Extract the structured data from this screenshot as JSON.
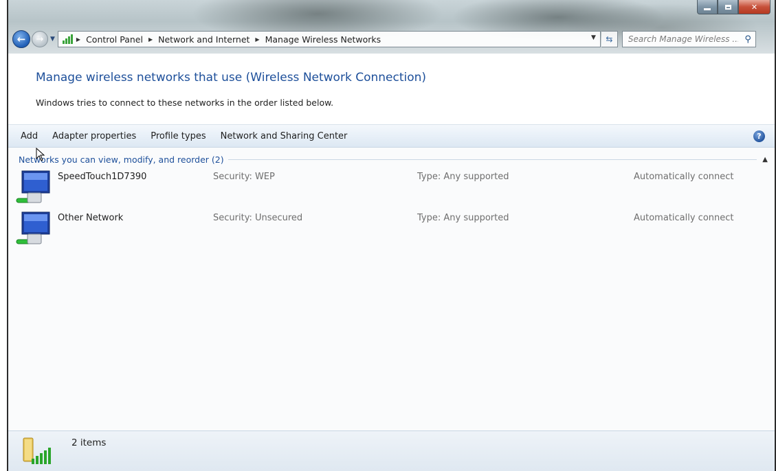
{
  "address_bar": {
    "breadcrumbs": [
      "Control Panel",
      "Network and Internet",
      "Manage Wireless Networks"
    ],
    "search_placeholder": "Search Manage Wireless ..."
  },
  "header": {
    "title": "Manage wireless networks that use (Wireless Network Connection)",
    "subtitle": "Windows tries to connect to these networks in the order listed below."
  },
  "toolbar": {
    "add": "Add",
    "adapter_properties": "Adapter properties",
    "profile_types": "Profile types",
    "network_sharing_center": "Network and Sharing Center"
  },
  "group": {
    "title": "Networks you can view, modify, and reorder (2)"
  },
  "networks": [
    {
      "name": "SpeedTouch1D7390",
      "security": "Security: WEP",
      "type": "Type: Any supported",
      "connect": "Automatically connect"
    },
    {
      "name": "Other Network",
      "security": "Security: Unsecured",
      "type": "Type: Any supported",
      "connect": "Automatically connect"
    }
  ],
  "status": {
    "item_count": "2 items"
  },
  "icons": {
    "back": "back-arrow-icon",
    "forward": "forward-arrow-icon",
    "refresh": "refresh-icon",
    "search": "search-icon",
    "help": "help-icon",
    "network": "wireless-network-icon"
  },
  "colors": {
    "heading": "#1d4f9a",
    "link": "#1d4f9a",
    "muted": "#6e6e6e"
  }
}
